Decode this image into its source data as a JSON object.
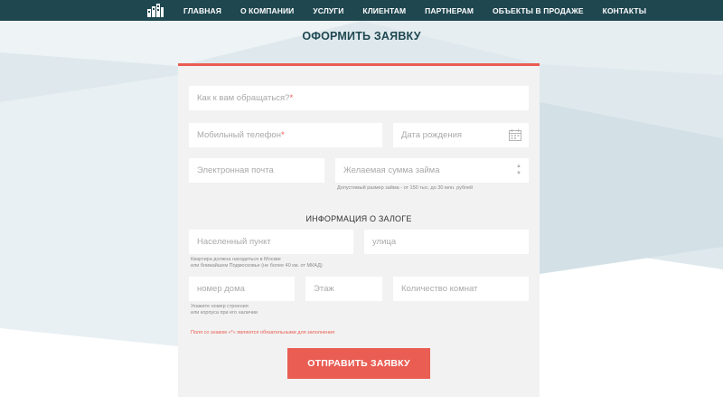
{
  "nav": {
    "logo": "building-logo",
    "items": [
      "ГЛАВНАЯ",
      "О КОМПАНИИ",
      "УСЛУГИ",
      "КЛИЕНТАМ",
      "ПАРТНЕРАМ",
      "ОБЪЕКТЫ В ПРОДАЖЕ",
      "КОНТАКТЫ"
    ]
  },
  "page_title": "ОФОРМИТЬ ЗАЯВКУ",
  "form": {
    "name_placeholder": "Как к вам обращаться?",
    "phone_placeholder": "Мобильный телефон",
    "required_mark": "*",
    "birthdate_placeholder": "Дата рождения",
    "email_placeholder": "Электронная почта",
    "amount_placeholder": "Желаемая сумма займа",
    "amount_hint": "Допустимый размер займа - от 150 тыс. до 30 млн. рублей",
    "collateral_title": "ИНФОРМАЦИЯ О ЗАЛОГЕ",
    "city_placeholder": "Населенный пункт",
    "street_placeholder": "улица",
    "location_hint_1": "Квартира должна находиться в Москве",
    "location_hint_2": "или ближайшем Подмосковье (не более 40 км. от МКАД)",
    "house_placeholder": "номер дома",
    "floor_placeholder": "Этаж",
    "rooms_placeholder": "Количество комнат",
    "house_hint_1": "Укажите номер строения",
    "house_hint_2": "или корпуса при его наличии",
    "required_note": "Поля со знаком «*» являются обязательными для заполнения",
    "submit_label": "ОТПРАВИТЬ ЗАЯВКУ"
  },
  "colors": {
    "nav_bg": "#1f4750",
    "accent": "#e95d53",
    "card_bg": "#f2f2f2",
    "bg_shape": "#dde8ec"
  }
}
